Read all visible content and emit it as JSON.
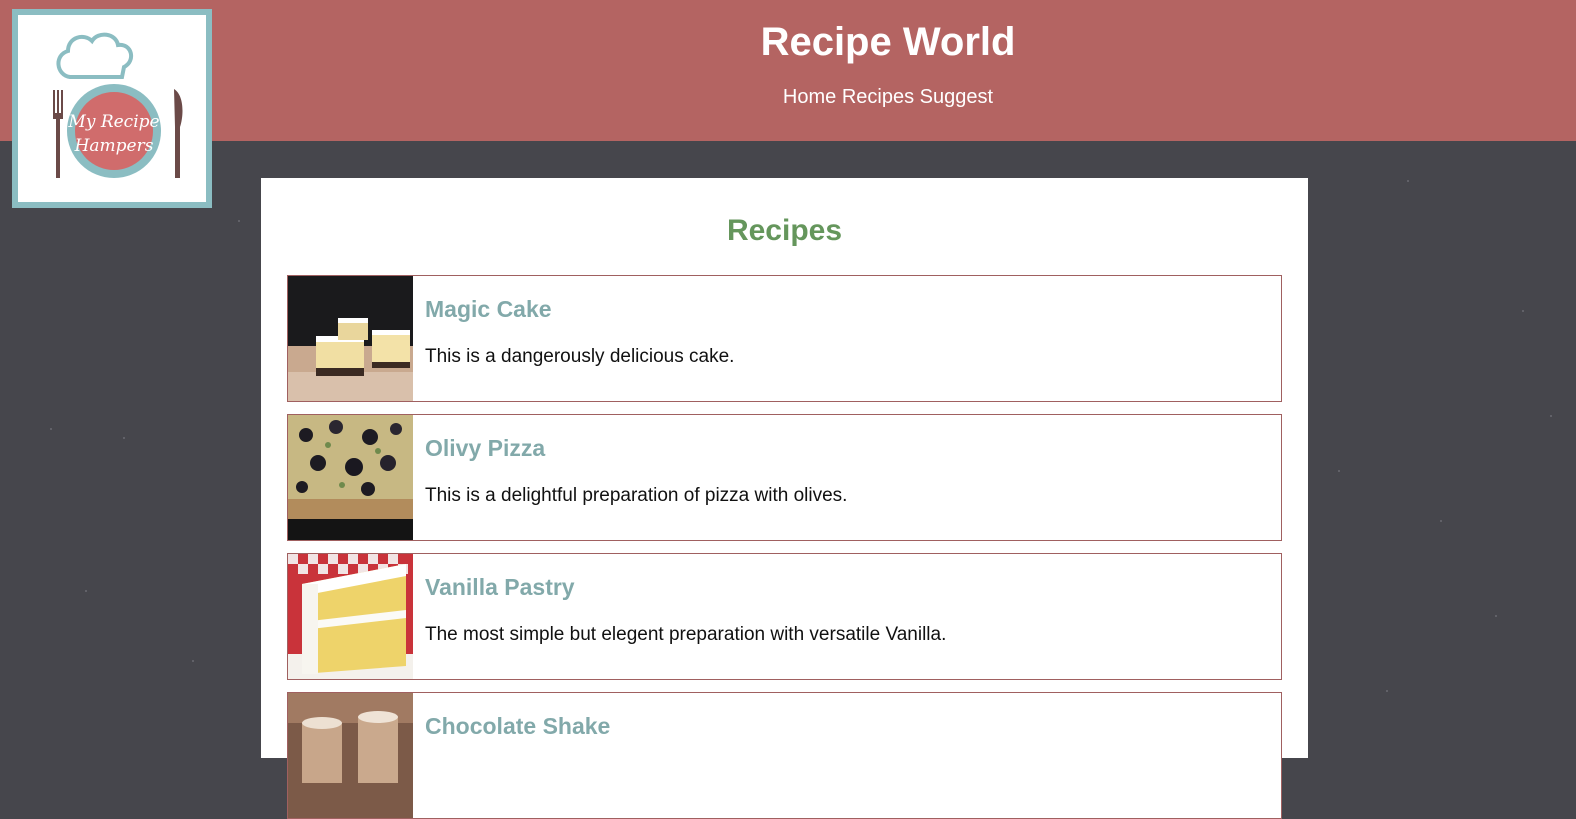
{
  "header": {
    "title": "Recipe World",
    "nav": [
      "Home",
      "Recipes",
      "Suggest"
    ]
  },
  "logo": {
    "text_line1": "My Recipe",
    "text_line2": "Hampers"
  },
  "main": {
    "heading": "Recipes",
    "recipes": [
      {
        "name": "Magic Cake",
        "description": "This is a dangerously delicious cake.",
        "image": "magic-cake-photo"
      },
      {
        "name": "Olivy Pizza",
        "description": "This is a delightful preparation of pizza with olives.",
        "image": "olive-pizza-photo"
      },
      {
        "name": "Vanilla Pastry",
        "description": "The most simple but elegent preparation with versatile Vanilla.",
        "image": "vanilla-pastry-photo"
      },
      {
        "name": "Chocolate Shake",
        "description": "",
        "image": "chocolate-shake-photo"
      }
    ]
  },
  "colors": {
    "header_bg": "#b46462",
    "page_bg": "#46464c",
    "heading_green": "#65965c",
    "recipe_title_teal": "#82a9aa",
    "card_border": "#a06060",
    "logo_border": "#8bbdc2"
  }
}
